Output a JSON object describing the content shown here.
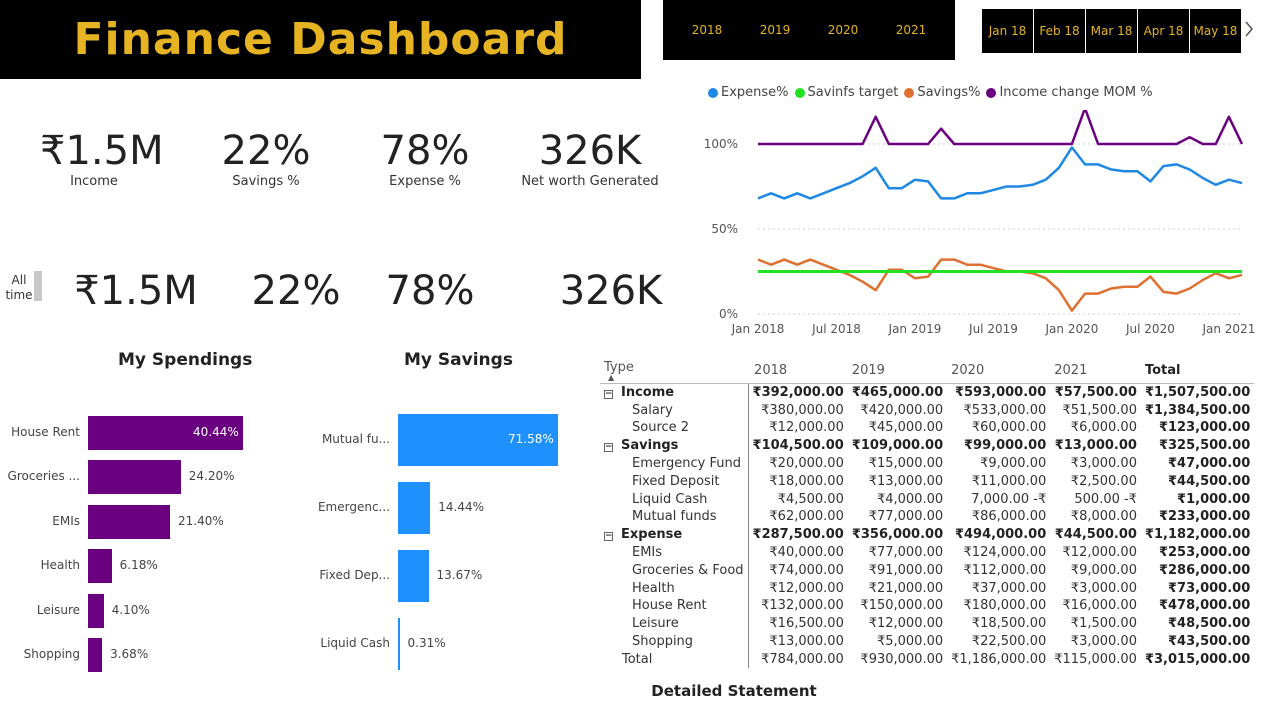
{
  "header": {
    "title": "Finance Dashboard"
  },
  "year_slicer": [
    "2018",
    "2019",
    "2020",
    "2021"
  ],
  "month_slicer": [
    "Jan 18",
    "Feb 18",
    "Mar 18",
    "Apr 18",
    "May 18"
  ],
  "month_next_icon": "chevron-right-icon",
  "kpis_top": [
    {
      "value": "₹1.5M",
      "label": "Income"
    },
    {
      "value": "22%",
      "label": "Savings %"
    },
    {
      "value": "78%",
      "label": "Expense %"
    },
    {
      "value": "326K",
      "label": "Net worth Generated"
    }
  ],
  "kpis_all_time": {
    "label": "All time",
    "values": [
      "₹1.5M",
      "22%",
      "78%",
      "326K"
    ]
  },
  "spendings": {
    "title": "My Spendings",
    "color": "#6a0080",
    "items": [
      {
        "label": "House Rent",
        "value": 40.44,
        "value_text": "40.44%"
      },
      {
        "label": "Groceries ...",
        "value": 24.2,
        "value_text": "24.20%"
      },
      {
        "label": "EMIs",
        "value": 21.4,
        "value_text": "21.40%"
      },
      {
        "label": "Health",
        "value": 6.18,
        "value_text": "6.18%"
      },
      {
        "label": "Leisure",
        "value": 4.1,
        "value_text": "4.10%"
      },
      {
        "label": "Shopping",
        "value": 3.68,
        "value_text": "3.68%"
      }
    ]
  },
  "savings": {
    "title": "My Savings",
    "color": "#1e90ff",
    "items": [
      {
        "label": "Mutual fu...",
        "value": 71.58,
        "value_text": "71.58%"
      },
      {
        "label": "Emergenc...",
        "value": 14.44,
        "value_text": "14.44%"
      },
      {
        "label": "Fixed Dep...",
        "value": 13.67,
        "value_text": "13.67%"
      },
      {
        "label": "Liquid Cash",
        "value": 0.31,
        "value_text": "0.31%"
      }
    ]
  },
  "chart_data": {
    "type": "line",
    "legend_position": "top-left",
    "ylim": [
      0,
      120
    ],
    "yticks": [
      "0%",
      "50%",
      "100%"
    ],
    "xticks": [
      "Jan 2018",
      "Jul 2018",
      "Jan 2019",
      "Jul 2019",
      "Jan 2020",
      "Jul 2020",
      "Jan 2021"
    ],
    "x": [
      "2018-01",
      "2018-02",
      "2018-03",
      "2018-04",
      "2018-05",
      "2018-06",
      "2018-07",
      "2018-08",
      "2018-09",
      "2018-10",
      "2018-11",
      "2018-12",
      "2019-01",
      "2019-02",
      "2019-03",
      "2019-04",
      "2019-05",
      "2019-06",
      "2019-07",
      "2019-08",
      "2019-09",
      "2019-10",
      "2019-11",
      "2019-12",
      "2020-01",
      "2020-02",
      "2020-03",
      "2020-04",
      "2020-05",
      "2020-06",
      "2020-07",
      "2020-08",
      "2020-09",
      "2020-10",
      "2020-11",
      "2020-12",
      "2021-01",
      "2021-02"
    ],
    "series": [
      {
        "name": "Expense%",
        "color": "#1e88e5",
        "values": [
          68,
          71,
          68,
          71,
          68,
          71,
          74,
          77,
          81,
          86,
          74,
          74,
          79,
          78,
          68,
          68,
          71,
          71,
          73,
          75,
          75,
          76,
          79,
          86,
          98,
          88,
          88,
          85,
          84,
          84,
          78,
          87,
          88,
          85,
          80,
          76,
          79,
          77
        ]
      },
      {
        "name": "Savinfs target",
        "color": "#22e022",
        "values": [
          25,
          25,
          25,
          25,
          25,
          25,
          25,
          25,
          25,
          25,
          25,
          25,
          25,
          25,
          25,
          25,
          25,
          25,
          25,
          25,
          25,
          25,
          25,
          25,
          25,
          25,
          25,
          25,
          25,
          25,
          25,
          25,
          25,
          25,
          25,
          25,
          25,
          25
        ]
      },
      {
        "name": "Savings%",
        "color": "#e07030",
        "values": [
          32,
          29,
          32,
          29,
          32,
          29,
          26,
          23,
          19,
          14,
          26,
          26,
          21,
          22,
          32,
          32,
          29,
          29,
          27,
          25,
          25,
          24,
          21,
          14,
          2,
          12,
          12,
          15,
          16,
          16,
          22,
          13,
          12,
          15,
          20,
          24,
          21,
          23
        ]
      },
      {
        "name": "Income change MOM %",
        "color": "#6a0080",
        "values": [
          100,
          100,
          100,
          100,
          100,
          100,
          100,
          100,
          100,
          116,
          100,
          100,
          100,
          100,
          109,
          100,
          100,
          100,
          100,
          100,
          100,
          100,
          100,
          100,
          100,
          121,
          100,
          100,
          100,
          100,
          100,
          100,
          100,
          104,
          100,
          100,
          116,
          100
        ]
      }
    ]
  },
  "statement": {
    "title": "Detailed Statement",
    "columns": [
      "Type",
      "2018",
      "2019",
      "2020",
      "2021",
      "Total"
    ],
    "rows": [
      {
        "kind": "group",
        "name": "Income",
        "vals": [
          "₹392,000.00",
          "₹465,000.00",
          "₹593,000.00",
          "₹57,500.00",
          "₹1,507,500.00"
        ]
      },
      {
        "kind": "item",
        "name": "Salary",
        "vals": [
          "₹380,000.00",
          "₹420,000.00",
          "₹533,000.00",
          "₹51,500.00",
          "₹1,384,500.00"
        ]
      },
      {
        "kind": "item",
        "name": "Source 2",
        "vals": [
          "₹12,000.00",
          "₹45,000.00",
          "₹60,000.00",
          "₹6,000.00",
          "₹123,000.00"
        ]
      },
      {
        "kind": "group",
        "name": "Savings",
        "vals": [
          "₹104,500.00",
          "₹109,000.00",
          "₹99,000.00",
          "₹13,000.00",
          "₹325,500.00"
        ]
      },
      {
        "kind": "item",
        "name": "Emergency Fund",
        "vals": [
          "₹20,000.00",
          "₹15,000.00",
          "₹9,000.00",
          "₹3,000.00",
          "₹47,000.00"
        ]
      },
      {
        "kind": "item",
        "name": "Fixed Deposit",
        "vals": [
          "₹18,000.00",
          "₹13,000.00",
          "₹11,000.00",
          "₹2,500.00",
          "₹44,500.00"
        ]
      },
      {
        "kind": "item",
        "name": "Liquid Cash",
        "vals": [
          "₹4,500.00",
          "₹4,000.00",
          "7,000.00 -₹",
          "500.00 -₹",
          "₹1,000.00"
        ]
      },
      {
        "kind": "item",
        "name": "Mutual funds",
        "vals": [
          "₹62,000.00",
          "₹77,000.00",
          "₹86,000.00",
          "₹8,000.00",
          "₹233,000.00"
        ]
      },
      {
        "kind": "group",
        "name": "Expense",
        "vals": [
          "₹287,500.00",
          "₹356,000.00",
          "₹494,000.00",
          "₹44,500.00",
          "₹1,182,000.00"
        ]
      },
      {
        "kind": "item",
        "name": "EMIs",
        "vals": [
          "₹40,000.00",
          "₹77,000.00",
          "₹124,000.00",
          "₹12,000.00",
          "₹253,000.00"
        ]
      },
      {
        "kind": "item",
        "name": "Groceries & Food",
        "vals": [
          "₹74,000.00",
          "₹91,000.00",
          "₹112,000.00",
          "₹9,000.00",
          "₹286,000.00"
        ]
      },
      {
        "kind": "item",
        "name": "Health",
        "vals": [
          "₹12,000.00",
          "₹21,000.00",
          "₹37,000.00",
          "₹3,000.00",
          "₹73,000.00"
        ]
      },
      {
        "kind": "item",
        "name": "House Rent",
        "vals": [
          "₹132,000.00",
          "₹150,000.00",
          "₹180,000.00",
          "₹16,000.00",
          "₹478,000.00"
        ]
      },
      {
        "kind": "item",
        "name": "Leisure",
        "vals": [
          "₹16,500.00",
          "₹12,000.00",
          "₹18,500.00",
          "₹1,500.00",
          "₹48,500.00"
        ]
      },
      {
        "kind": "item",
        "name": "Shopping",
        "vals": [
          "₹13,000.00",
          "₹5,000.00",
          "₹22,500.00",
          "₹3,000.00",
          "₹43,500.00"
        ]
      },
      {
        "kind": "total",
        "name": "Total",
        "vals": [
          "₹784,000.00",
          "₹930,000.00",
          "₹1,186,000.00",
          "₹115,000.00",
          "₹3,015,000.00"
        ]
      }
    ]
  }
}
